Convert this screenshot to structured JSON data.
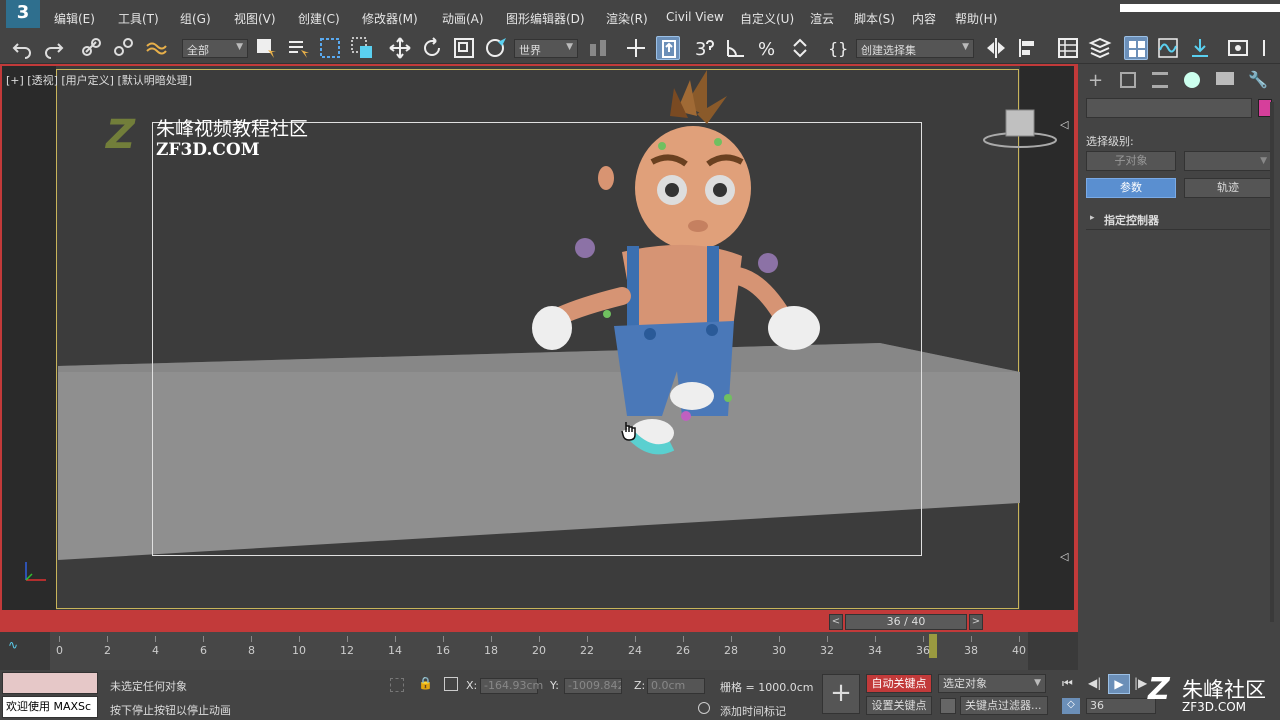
{
  "menubar": {
    "items": [
      "编辑(E)",
      "工具(T)",
      "组(G)",
      "视图(V)",
      "创建(C)",
      "修改器(M)",
      "动画(A)",
      "图形编辑器(D)",
      "渲染(R)",
      "Civil View",
      "自定义(U)",
      "渲云",
      "脚本(S)",
      "内容",
      "帮助(H)"
    ]
  },
  "toolbar": {
    "selection_filter": "全部",
    "reference_coord": "世界",
    "named_selection": "创建选择集"
  },
  "viewport": {
    "label": "[+] [透视] [用户定义] [默认明暗处理]",
    "watermark_cn": "朱峰视频教程社区",
    "watermark_en": "ZF3D.COM"
  },
  "right_panel": {
    "selection_level_label": "选择级别:",
    "sub_object_button": "子对象",
    "params_button": "参数",
    "trajectory_button": "轨迹",
    "assign_controller": "指定控制器",
    "accent_color": "#d63f9b"
  },
  "timeline": {
    "frame_display": "36 / 40",
    "ticks": [
      "0",
      "2",
      "4",
      "6",
      "8",
      "10",
      "12",
      "14",
      "16",
      "18",
      "20",
      "22",
      "24",
      "26",
      "28",
      "30",
      "32",
      "34",
      "36",
      "38",
      "40"
    ]
  },
  "status": {
    "welcome": "欢迎使用 MAXSc",
    "no_selection": "未选定任何对象",
    "hint": "按下停止按钮以停止动画",
    "x_label": "X:",
    "x_value": "-164.93cm",
    "y_label": "Y:",
    "y_value": "-1009.842c",
    "z_label": "Z:",
    "z_value": "0.0cm",
    "grid": "栅格 = 1000.0cm",
    "add_time_tag": "添加时间标记",
    "auto_key": "自动关键点",
    "set_key": "设置关键点",
    "selected_objects": "选定对象",
    "key_filters": "关键点过滤器...",
    "frame_field": "36",
    "brand_cn": "朱峰社区",
    "brand_en": "ZF3D.COM"
  }
}
